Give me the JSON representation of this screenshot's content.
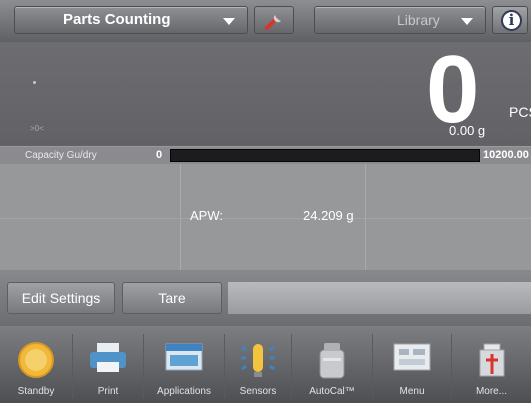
{
  "header": {
    "application": "Parts Counting",
    "library": "Library"
  },
  "display": {
    "main_value": "0",
    "unit": "PCS",
    "gross_weight": "0.00 g"
  },
  "capacity": {
    "label": "Capacity Gu/dry",
    "min": "0",
    "max": "10200.00"
  },
  "fields": {
    "apw_label": "APW:",
    "apw_value": "24.209 g"
  },
  "actions": {
    "edit_settings": "Edit Settings",
    "tare": "Tare"
  },
  "nav": [
    {
      "label": "Standby",
      "icon": "standby-icon"
    },
    {
      "label": "Print",
      "icon": "printer-icon"
    },
    {
      "label": "Applications",
      "icon": "applications-icon"
    },
    {
      "label": "Sensors",
      "icon": "sensors-icon"
    },
    {
      "label": "AutoCal™",
      "icon": "autocal-icon"
    },
    {
      "label": "Menu",
      "icon": "menu-icon"
    },
    {
      "label": "More...",
      "icon": "more-icon"
    }
  ],
  "colors": {
    "background": "#6d6d70",
    "capacity_bar": "#1c1c1e",
    "standby_accent": "#f0b93a",
    "print_accent": "#4f93c9",
    "info_accent": "#2f3a57"
  }
}
